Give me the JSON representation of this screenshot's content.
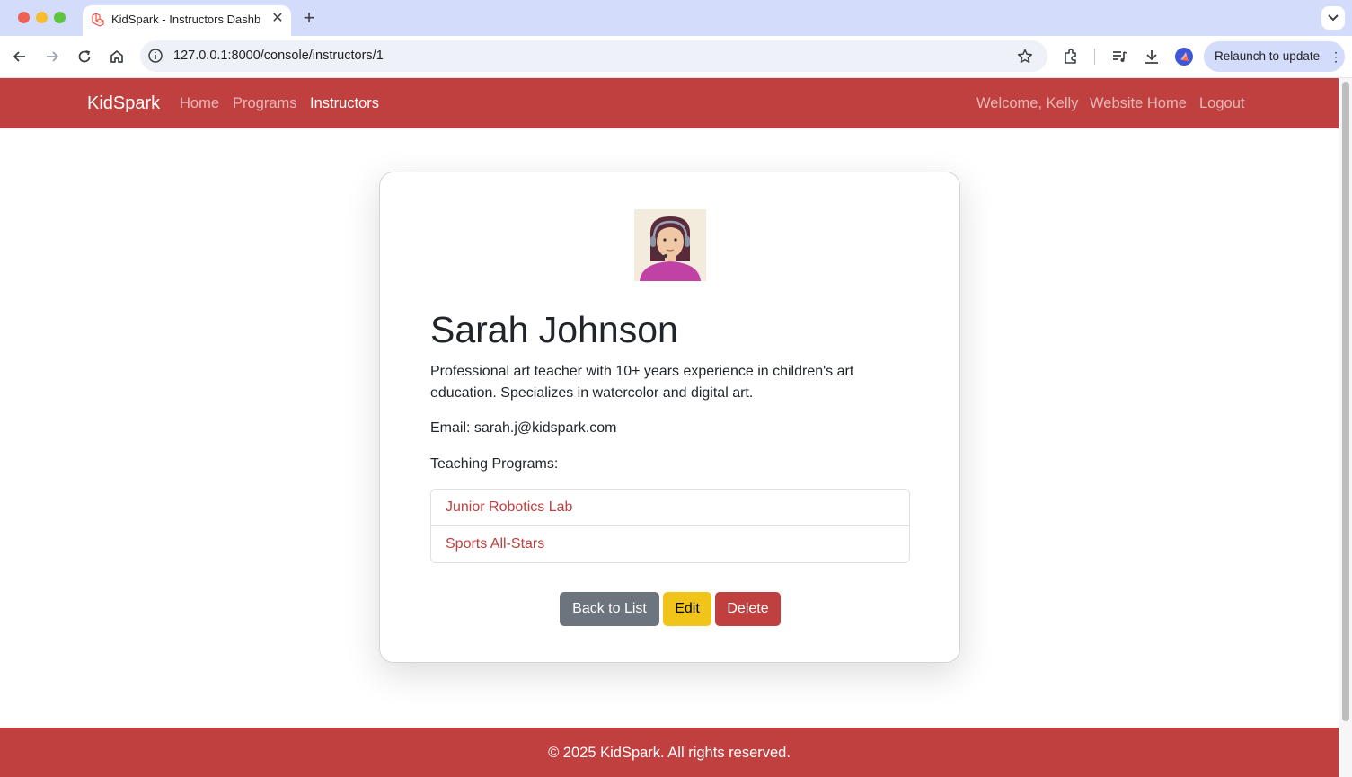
{
  "browser": {
    "tab_title": "KidSpark - Instructors Dashboard",
    "tab_close": "✕",
    "new_tab": "+",
    "url": "127.0.0.1:8000/console/instructors/1",
    "relaunch_label": "Relaunch to update",
    "relaunch_menu": "⋮"
  },
  "navbar": {
    "brand": "KidSpark",
    "links": [
      {
        "label": "Home"
      },
      {
        "label": "Programs"
      },
      {
        "label": "Instructors"
      }
    ],
    "active_link": "Instructors",
    "right_links": [
      {
        "label": "Welcome, Kelly"
      },
      {
        "label": "Website Home"
      },
      {
        "label": "Logout"
      }
    ]
  },
  "instructor": {
    "avatar_icon": "instructor-avatar-headset",
    "name": "Sarah Johnson",
    "bio": "Professional art teacher with 10+ years experience in children's art education. Specializes in watercolor and digital art.",
    "email": "Email: sarah.j@kidspark.com",
    "programs_label": "Teaching Programs:",
    "programs": [
      {
        "name": "Junior Robotics Lab"
      },
      {
        "name": "Sports All-Stars"
      }
    ]
  },
  "actions": {
    "back_label": "Back to List",
    "edit_label": "Edit",
    "delete_label": "Delete"
  },
  "footer": {
    "text": "© 2025 KidSpark. All rights reserved."
  },
  "colors": {
    "brand_red": "#c03f3f",
    "edit_yellow": "#f0c419",
    "secondary_gray": "#6c757d",
    "chrome_blue": "#d3dcfb"
  }
}
